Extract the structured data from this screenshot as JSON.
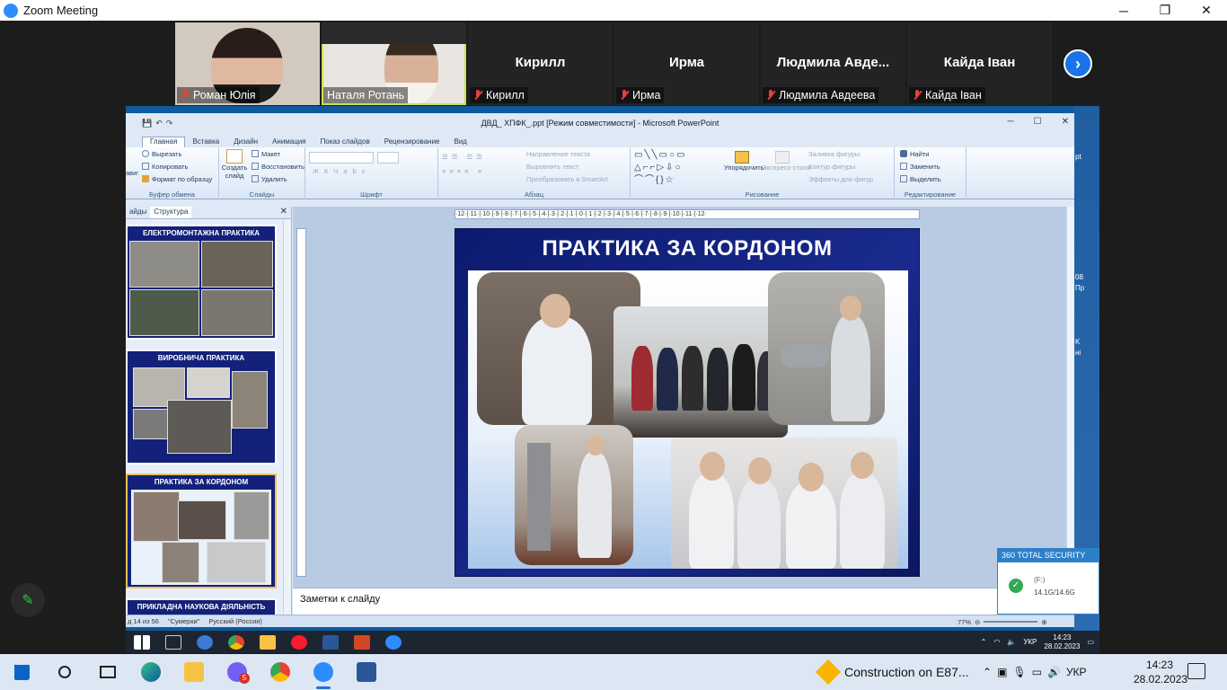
{
  "window": {
    "title": "Zoom Meeting",
    "min": "─",
    "max": "❐",
    "close": "✕"
  },
  "participants": [
    {
      "name": "Роман Юлія",
      "bigname": "",
      "video": true,
      "muted": true
    },
    {
      "name": "Наталя Ротань",
      "bigname": "",
      "video": true,
      "muted": false,
      "active": true
    },
    {
      "name": "Кирилл",
      "bigname": "Кирилл",
      "video": false,
      "muted": true
    },
    {
      "name": "Ирма",
      "bigname": "Ирма",
      "video": false,
      "muted": true
    },
    {
      "name": "Людмила Авдеева",
      "bigname": "Людмила  Авде...",
      "video": false,
      "muted": true
    },
    {
      "name": "Кайда Іван",
      "bigname": "Кайда Іван",
      "video": false,
      "muted": true
    }
  ],
  "ppt": {
    "title": "ДВД_ ХПФК_.ppt [Режим совместимости] - Microsoft PowerPoint",
    "tabs": [
      "Главная",
      "Вставка",
      "Дизайн",
      "Анимация",
      "Показ слайдов",
      "Рецензирование",
      "Вид"
    ],
    "groups": {
      "clipboard": {
        "label": "Буфер обмена",
        "items": [
          "Вырезать",
          "Копировать",
          "Формат по образцу"
        ],
        "paste": "авить"
      },
      "slides": {
        "label": "Слайды",
        "create": "Создать слайд",
        "items": [
          "Макет",
          "Восстановить",
          "Удалить"
        ]
      },
      "font": {
        "label": "Шрифт"
      },
      "paragraph": {
        "label": "Абзац",
        "items": [
          "Направление текста",
          "Выровнять текст",
          "Преобразовать в SmartArt"
        ]
      },
      "drawing": {
        "label": "Рисование",
        "arrange": "Упорядочить",
        "styles": "Экспресс-стили",
        "items": [
          "Заливка фигуры",
          "Контур фигуры",
          "Эффекты для фигур"
        ]
      },
      "editing": {
        "label": "Редактирование",
        "items": [
          "Найти",
          "Заменить",
          "Выделить"
        ]
      }
    },
    "left_tabs": [
      "айды",
      "Структура"
    ],
    "thumbnails": [
      {
        "title": "ЕЛЕКТРОМОНТАЖНА ПРАКТИКА"
      },
      {
        "title": "ВИРОБНИЧА ПРАКТИКА"
      },
      {
        "title": "ПРАКТИКА ЗА КОРДОНОМ"
      },
      {
        "title": "ПРИКЛАДНА НАУКОВА ДІЯЛЬНІСТЬ"
      }
    ],
    "ruler": "·12·|·11·|·10·|·9·|·8·|·7·|·6·|·5·|·4·|·3·|·2·|·1·|·0·|·1·|·2·|·3·|·4·|·5·|·6·|·7·|·8·|·9·|·10·|·11·|·12·",
    "slide_title": "ПРАКТИКА ЗА КОРДОНОМ",
    "notes": "Заметки к слайду",
    "status": {
      "slide": "д 14 из 56",
      "theme": "\"Сумерки\"",
      "lang": "Русский (Россия)",
      "zoom": "77%"
    }
  },
  "desktop_edge": [
    "pt",
    "08",
    "Пр",
    "K",
    "ні"
  ],
  "security": {
    "title": "360 TOTAL SECURITY",
    "drive": "(F:)",
    "size": "14.1G/14.6G"
  },
  "remote_tray": {
    "lang": "УКР",
    "time": "14:23",
    "date": "28.02.2023"
  },
  "taskbar": {
    "news": "Construction on E87...",
    "lang": "УКР",
    "time": "14:23",
    "date": "28.02.2023",
    "viber_badge": "5"
  }
}
